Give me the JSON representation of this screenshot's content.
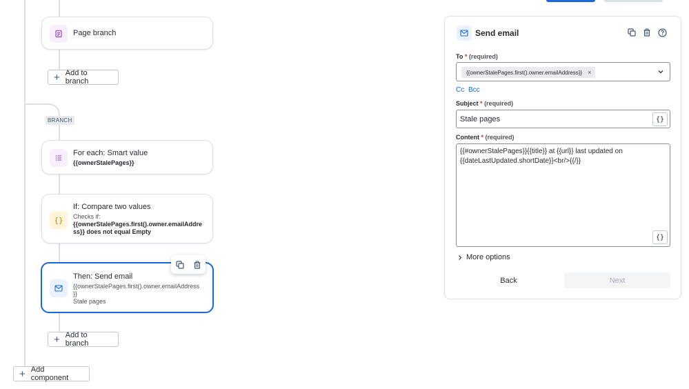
{
  "canvas": {
    "cards": {
      "page_branch": {
        "title": "Page branch"
      },
      "for_each": {
        "title": "For each: Smart value",
        "detail": "{{ownerStalePages}}"
      },
      "if_compare": {
        "title": "If: Compare two values",
        "detail_prefix": "Checks if:",
        "detail_line1": "{{ownerStalePages.first().owner.emailAddre",
        "detail_line2": "ss}} does not equal Empty"
      },
      "then_send": {
        "title": "Then: Send email",
        "detail_line1": "{{ownerStalePages.first().owner.emailAddress",
        "detail_line2": "}}",
        "detail_line3": "Stale pages"
      }
    },
    "add_to_branch_label": "Add to branch",
    "branch_tag": "BRANCH",
    "add_component_label": "Add component"
  },
  "panel": {
    "title": "Send email",
    "to": {
      "label": "To",
      "required_hint": "(required)",
      "chip": "{{ownerStalePages.first().owner.emailAddress}}"
    },
    "cc_label": "Cc",
    "bcc_label": "Bcc",
    "subject": {
      "label": "Subject",
      "required_hint": "(required)",
      "value": "Stale pages"
    },
    "content": {
      "label": "Content",
      "required_hint": "(required)",
      "line1": "{{#ownerStalePages}}{{title}} at {{url}} last updated on",
      "line2": "{{dateLastUpdated.shortDate}}<br/>{{/}}"
    },
    "more_options_label": "More options",
    "back_label": "Back",
    "next_label": "Next"
  },
  "icons": {
    "page": "page-icon",
    "list": "list-icon",
    "braces": "braces-icon",
    "email": "email-icon",
    "copy": "copy-icon",
    "trash": "trash-icon",
    "help": "help-icon",
    "plus": "plus-icon",
    "chevron_down": "chevron-down-icon",
    "chevron_right": "chevron-right-icon"
  },
  "colors": {
    "accent": "#1868db",
    "required": "#c9372c",
    "page_icon_bg": "#f8eefe",
    "page_icon_fg": "#964ac0",
    "braces_icon_bg": "#fff5db",
    "braces_icon_fg": "#b38600",
    "email_icon_bg": "#e9f2fe"
  }
}
